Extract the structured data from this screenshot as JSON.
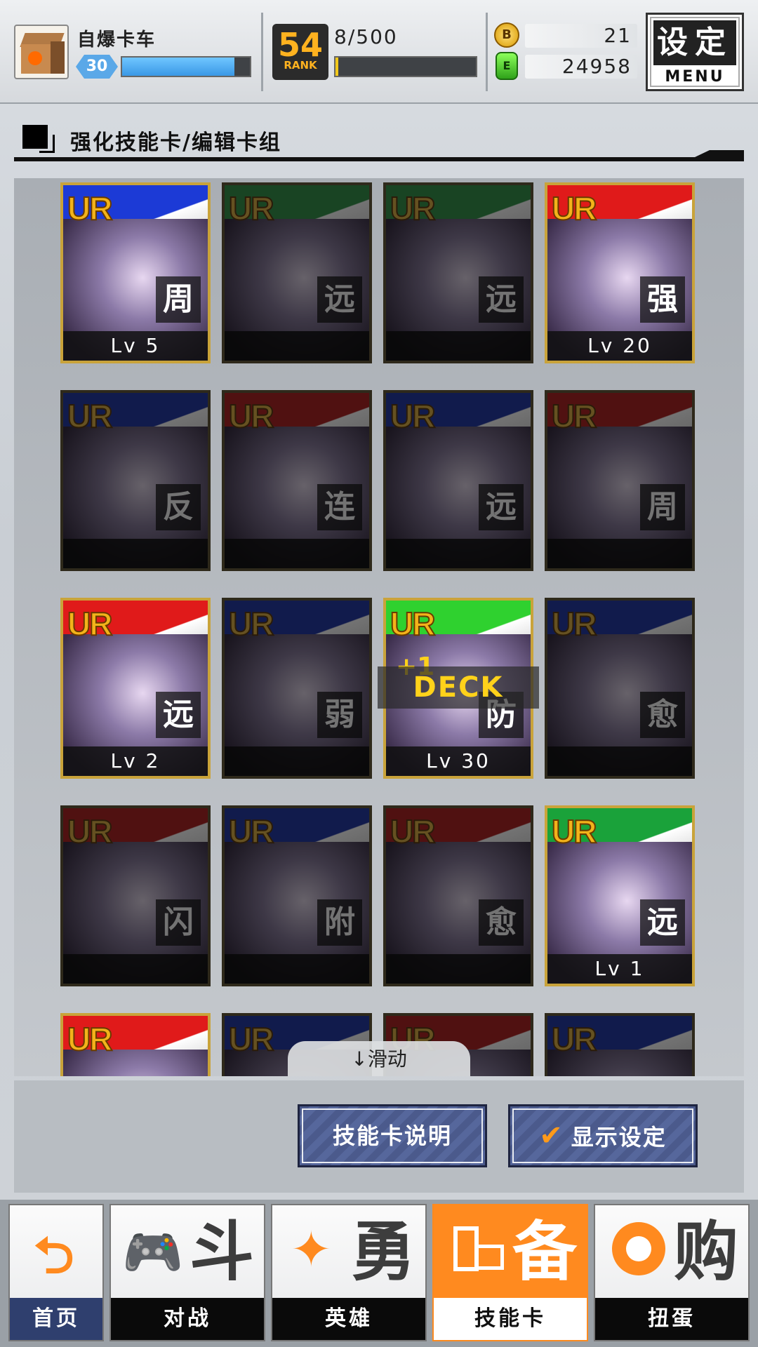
{
  "player": {
    "name": "自爆卡车",
    "level": "30",
    "level_progress": 0.88
  },
  "rank": {
    "value": "54",
    "label": "RANK",
    "progress_text": "8/500",
    "progress": 0.02
  },
  "currency": {
    "coin_symbol": "B",
    "coins": "21",
    "gem_symbol": "E",
    "gems": "24958"
  },
  "menu_button": {
    "cn": "设定",
    "en": "MENU"
  },
  "section": {
    "title": "强化技能卡/编辑卡组"
  },
  "cards": [
    {
      "rarity": "UR",
      "type": "周",
      "level": "Lv 5",
      "owned": true,
      "color": "#1c3ad6"
    },
    {
      "rarity": "UR",
      "type": "远",
      "level": "",
      "owned": false,
      "color": "#1aa23a"
    },
    {
      "rarity": "UR",
      "type": "远",
      "level": "",
      "owned": false,
      "color": "#1aa23a"
    },
    {
      "rarity": "UR",
      "type": "强",
      "level": "Lv 20",
      "owned": true,
      "color": "#e01a1a"
    },
    {
      "rarity": "UR",
      "type": "反",
      "level": "",
      "owned": false,
      "color": "#1c3ad6"
    },
    {
      "rarity": "UR",
      "type": "连",
      "level": "",
      "owned": false,
      "color": "#e01a1a"
    },
    {
      "rarity": "UR",
      "type": "远",
      "level": "",
      "owned": false,
      "color": "#1c3ad6"
    },
    {
      "rarity": "UR",
      "type": "周",
      "level": "",
      "owned": false,
      "color": "#e01a1a"
    },
    {
      "rarity": "UR",
      "type": "远",
      "level": "Lv 2",
      "owned": true,
      "color": "#e01a1a"
    },
    {
      "rarity": "UR",
      "type": "弱",
      "level": "",
      "owned": false,
      "color": "#1c3ad6"
    },
    {
      "rarity": "UR",
      "type": "防",
      "level": "Lv 30",
      "owned": true,
      "color": "#2fd12f"
    },
    {
      "rarity": "UR",
      "type": "愈",
      "level": "",
      "owned": false,
      "color": "#1c3ad6"
    },
    {
      "rarity": "UR",
      "type": "闪",
      "level": "",
      "owned": false,
      "color": "#e01a1a"
    },
    {
      "rarity": "UR",
      "type": "附",
      "level": "",
      "owned": false,
      "color": "#1c3ad6"
    },
    {
      "rarity": "UR",
      "type": "愈",
      "level": "",
      "owned": false,
      "color": "#e01a1a"
    },
    {
      "rarity": "UR",
      "type": "远",
      "level": "Lv 1",
      "owned": true,
      "color": "#1aa23a"
    },
    {
      "rarity": "UR",
      "type": "",
      "level": "",
      "owned": true,
      "color": "#e01a1a"
    },
    {
      "rarity": "UR",
      "type": "",
      "level": "",
      "owned": false,
      "color": "#1c3ad6"
    },
    {
      "rarity": "UR",
      "type": "",
      "level": "",
      "owned": false,
      "color": "#e01a1a"
    },
    {
      "rarity": "UR",
      "type": "",
      "level": "",
      "owned": false,
      "color": "#1c3ad6"
    }
  ],
  "deck_tag": {
    "plus": "+1",
    "label": "DECK"
  },
  "scroll_hint": "↓滑动",
  "buttons": {
    "card_info": "技能卡说明",
    "display_settings": "显示设定",
    "check": "✔"
  },
  "nav": [
    {
      "label": "首页",
      "big": "",
      "active": false
    },
    {
      "label": "对战",
      "big": "斗",
      "active": false
    },
    {
      "label": "英雄",
      "big": "勇",
      "active": false
    },
    {
      "label": "技能卡",
      "big": "备",
      "active": true
    },
    {
      "label": "扭蛋",
      "big": "购",
      "active": false
    }
  ]
}
